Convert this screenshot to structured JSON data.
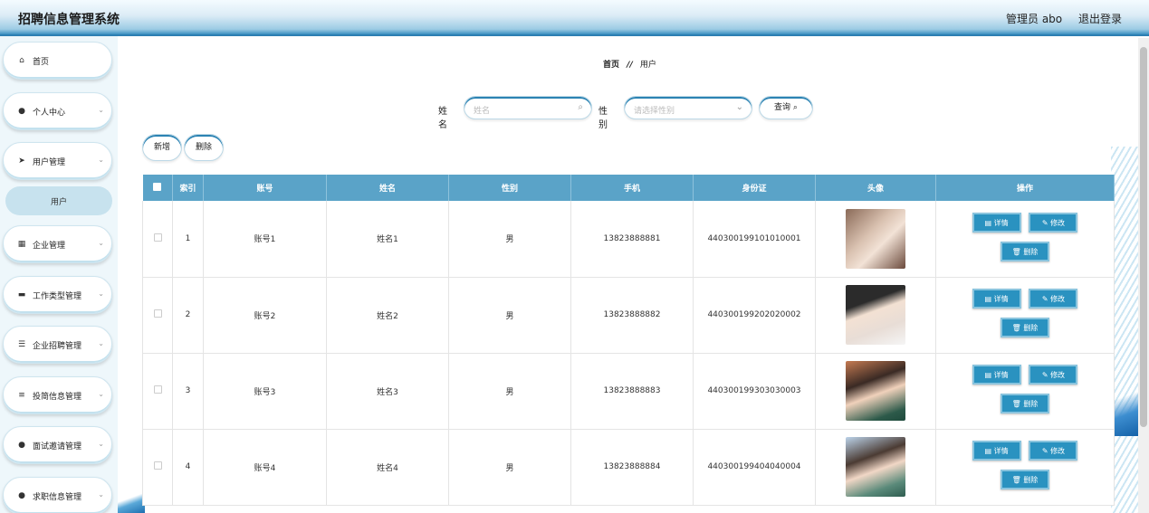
{
  "header": {
    "title": "招聘信息管理系统",
    "user_label": "管理员 abo",
    "logout_label": "退出登录"
  },
  "sidebar": {
    "items": [
      {
        "label": "首页",
        "icon": "home-icon",
        "glyph": "⌂"
      },
      {
        "label": "个人中心",
        "icon": "person-icon",
        "glyph": "●"
      },
      {
        "label": "用户管理",
        "icon": "send-icon",
        "glyph": "➤"
      },
      {
        "label": "企业管理",
        "icon": "grid-icon",
        "glyph": "▦"
      },
      {
        "label": "工作类型管理",
        "icon": "layers-icon",
        "glyph": "▬"
      },
      {
        "label": "企业招聘管理",
        "icon": "sliders-icon",
        "glyph": "☰"
      },
      {
        "label": "投简信息管理",
        "icon": "list-icon",
        "glyph": "≡"
      },
      {
        "label": "面试邀请管理",
        "icon": "location-pin-icon",
        "glyph": "●"
      },
      {
        "label": "求职信息管理",
        "icon": "person-icon",
        "glyph": "●"
      }
    ],
    "sub_item": "用户"
  },
  "breadcrumb": {
    "home": "首页",
    "separator": "//",
    "current": "用户"
  },
  "search": {
    "name_label": "姓名",
    "name_placeholder": "姓名",
    "gender_label": "性别",
    "gender_placeholder": "请选择性别",
    "query_button": "查询"
  },
  "actions": {
    "add": "新增",
    "delete": "删除"
  },
  "table": {
    "columns": [
      "索引",
      "账号",
      "姓名",
      "性别",
      "手机",
      "身份证",
      "头像",
      "操作"
    ],
    "rows": [
      {
        "index": "1",
        "account": "账号1",
        "name": "姓名1",
        "gender": "男",
        "phone": "13823888881",
        "id_card": "440300199101010001"
      },
      {
        "index": "2",
        "account": "账号2",
        "name": "姓名2",
        "gender": "男",
        "phone": "13823888882",
        "id_card": "440300199202020002"
      },
      {
        "index": "3",
        "account": "账号3",
        "name": "姓名3",
        "gender": "男",
        "phone": "13823888883",
        "id_card": "440300199303030003"
      },
      {
        "index": "4",
        "account": "账号4",
        "name": "姓名4",
        "gender": "男",
        "phone": "13823888884",
        "id_card": "440300199404040004"
      }
    ],
    "row_buttons": {
      "detail": "详情",
      "edit": "修改",
      "delete": "删除"
    }
  }
}
